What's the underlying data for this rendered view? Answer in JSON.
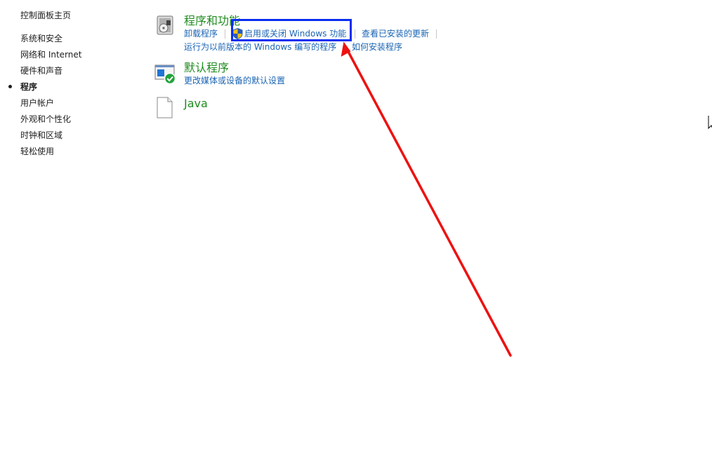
{
  "nav": {
    "home": "控制面板主页",
    "items": [
      {
        "label": "系统和安全",
        "current": false
      },
      {
        "label": "网络和 Internet",
        "current": false
      },
      {
        "label": "硬件和声音",
        "current": false
      },
      {
        "label": "程序",
        "current": true
      },
      {
        "label": "用户帐户",
        "current": false
      },
      {
        "label": "外观和个性化",
        "current": false
      },
      {
        "label": "时钟和区域",
        "current": false
      },
      {
        "label": "轻松使用",
        "current": false
      }
    ]
  },
  "sections": {
    "programs_features": {
      "title": "程序和功能",
      "links": {
        "uninstall": "卸载程序",
        "windows_features": "启用或关闭 Windows 功能",
        "view_updates": "查看已安装的更新",
        "compat": "运行为以前版本的 Windows 编写的程序",
        "how_install": "如何安装程序"
      }
    },
    "default_programs": {
      "title": "默认程序",
      "links": {
        "change_defaults": "更改媒体或设备的默认设置"
      }
    },
    "java": {
      "title": "Java"
    }
  },
  "annotations": {
    "highlight_color": "#0a2ff0",
    "arrow_color": "#ee1111"
  },
  "colors": {
    "title_green": "#1e8c1e",
    "link_blue": "#1a64b4"
  }
}
